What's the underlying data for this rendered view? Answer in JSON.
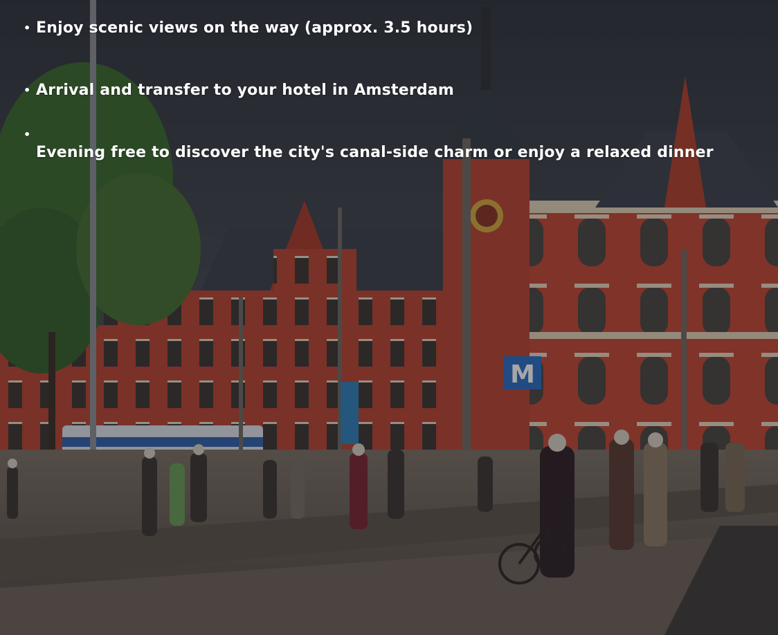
{
  "itinerary": {
    "items": [
      "Enjoy scenic views on the way (approx. 3.5 hours)",
      "Arrival and transfer to your hotel in Amsterdam",
      "Evening free to discover the city's canal-side charm or enjoy a relaxed dinner"
    ]
  },
  "background": {
    "sign_metro": "M"
  },
  "colors": {
    "sky": "#3a3f46",
    "brick": "#b5412c",
    "roof": "#3c4149",
    "pavement": "#6b6258",
    "tree": "#3f6b2e",
    "text": "#ffffff"
  }
}
